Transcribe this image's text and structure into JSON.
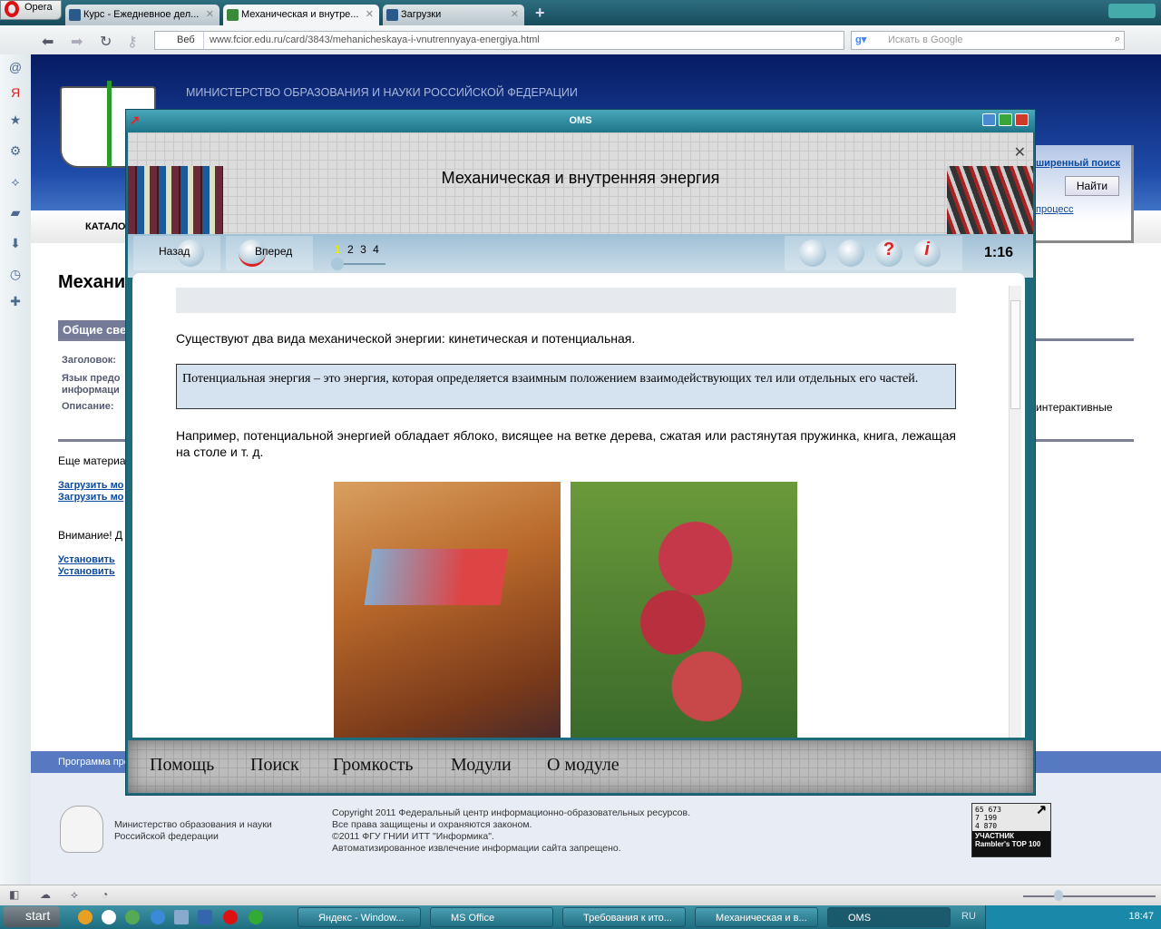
{
  "browser": {
    "menu_label": "Opera",
    "tabs": [
      {
        "label": "Курс - Ежедневное дел..."
      },
      {
        "label": "Механическая и внутре..."
      },
      {
        "label": "Загрузки"
      }
    ],
    "address_prefix": "Веб",
    "url": "www.fcior.edu.ru/card/3843/mehanicheskaya-i-vnutrennyaya-energiya.html",
    "search_placeholder": "Искать в Google"
  },
  "site": {
    "ministry": "МИНИСТЕРСТВО ОБРАЗОВАНИЯ И НАУКИ РОССИЙСКОЙ ФЕДЕРАЦИИ",
    "catalog": "КАТАЛО",
    "advanced_search": "ширенный поиск",
    "find_button": "Найти",
    "process_link": "процесс",
    "title": "Механи",
    "general_tab": "Общие све",
    "labels": [
      "Заголовок:",
      "Язык предо",
      "информаци",
      "Описание:"
    ],
    "desc_right": "интерактивные",
    "more": "Еще материа",
    "load_links": [
      "Загрузить мо",
      "Загрузить мо"
    ],
    "warning": "Внимание! Д",
    "install_links": [
      "Установить",
      "Установить"
    ],
    "program": "Программа про",
    "footer_ministry": [
      "Министерство образования и науки",
      "Российской федерации"
    ],
    "copyright": [
      "Copyright 2011 Федеральный центр информационно-образовательных ресурсов.",
      "Все права защищены и охраняются законом.",
      "©2011 ФГУ ГНИИ ИТТ \"Информика\".",
      "Автоматизированное извлечение информации сайта запрещено."
    ],
    "counter": [
      "65 673",
      "7 199",
      "4 870"
    ],
    "rambler": "УЧАСТНИК Rambler's TOP 100"
  },
  "oms": {
    "window_title": "OMS",
    "heading": "Механическая и внутренняя энергия",
    "back": "Назад",
    "forward": "Вперед",
    "pages": [
      "1",
      "2",
      "3",
      "4"
    ],
    "current_page": 1,
    "timer": "1:16",
    "text1": "Существуют два вида механической энергии: кинетическая и потенциальная.",
    "definition": "Потенциальная энергия – это энергия, которая определяется взаимным положением взаимодействующих тел или отдельных его частей.",
    "text2": "Например, потенциальной энергией обладает яблоко, висящее на ветке дерева, сжатая или растянутая пружинка, книга, лежащая на столе и т. д.",
    "menu": [
      "Помощь",
      "Поиск",
      "Громкость",
      "Модули",
      "О модуле"
    ]
  },
  "taskbar": {
    "start": "start",
    "items": [
      "Яндекс - Window...",
      "MS Office",
      "Требования к ито...",
      "Механическая и в...",
      "OMS"
    ],
    "lang": "RU",
    "clock": "18:47"
  }
}
